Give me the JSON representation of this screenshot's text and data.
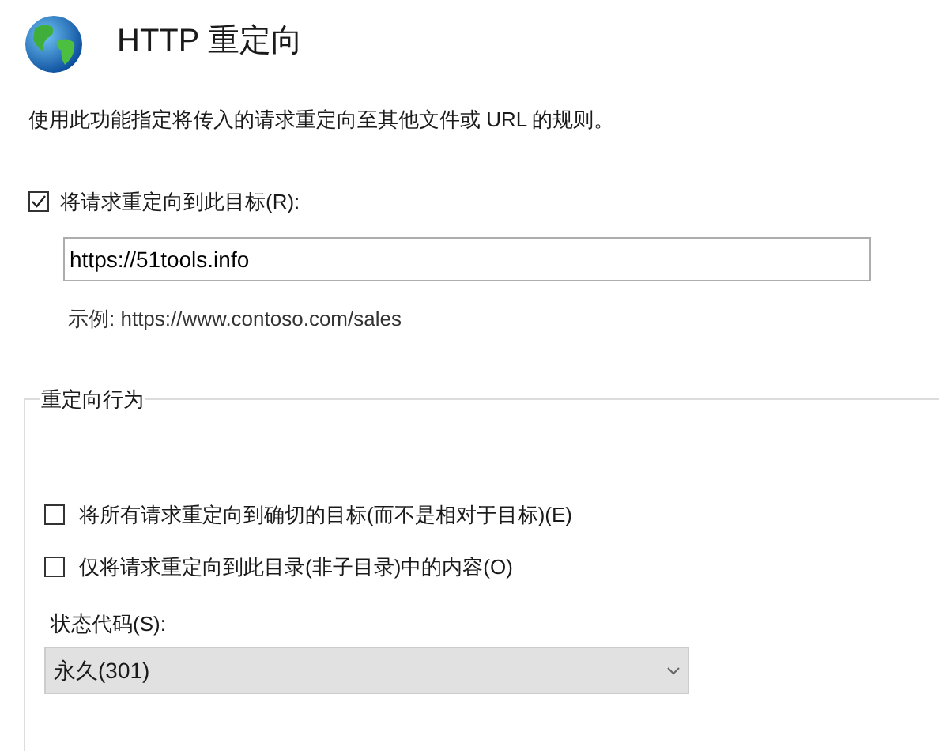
{
  "title": "HTTP 重定向",
  "description": "使用此功能指定将传入的请求重定向至其他文件或 URL 的规则。",
  "redirect": {
    "label": "将请求重定向到此目标(R):",
    "checked": true,
    "value": "https://51tools.info",
    "example": "示例: https://www.contoso.com/sales"
  },
  "behavior": {
    "legend": "重定向行为",
    "options": [
      {
        "label": "将所有请求重定向到确切的目标(而不是相对于目标)(E)",
        "checked": false
      },
      {
        "label": "仅将请求重定向到此目录(非子目录)中的内容(O)",
        "checked": false
      }
    ],
    "status_code": {
      "label": "状态代码(S):",
      "value": "永久(301)"
    }
  }
}
